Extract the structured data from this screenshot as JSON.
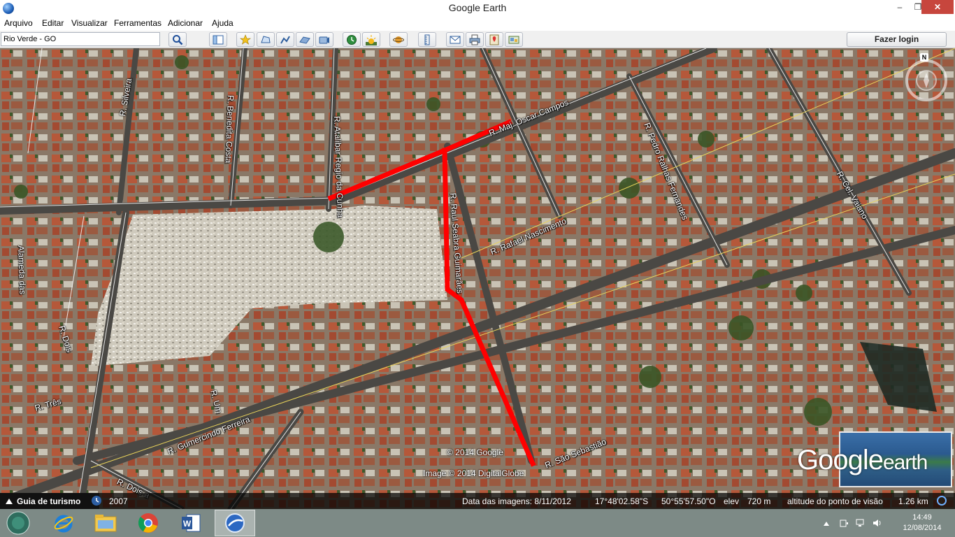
{
  "window": {
    "title": "Google Earth",
    "controls": {
      "minimize": "–",
      "maximize": "❐",
      "close": "✕"
    }
  },
  "menu": [
    "Arquivo",
    "Editar",
    "Visualizar",
    "Ferramentas",
    "Adicionar",
    "Ajuda"
  ],
  "toolbar": {
    "search_value": "Rio Verde - GO",
    "login_label": "Fazer login"
  },
  "map": {
    "streets": [
      "R. Atalibar Regio da Cunha",
      "R. Benedita Costa",
      "R. Silveira",
      "R. Maj. Oscar Campos",
      "R. Pedro Ralhas Fernandes",
      "R. Cel. Vaiano",
      "R. Rafael Nascimento",
      "R. Raul Seabra Guimarães",
      "Alameda das",
      "R. Dois",
      "R. Três",
      "R. Um",
      "R. Gumercindo Ferreira",
      "R. Dois-a",
      "R. São Sebastião"
    ],
    "copyright_google": "© 2014 Google",
    "copyright_imagery": "Image © 2014 DigitalGlobe",
    "route_color": "#ff0000",
    "north_label": "N"
  },
  "logo": {
    "word1": "Google",
    "word2": "earth"
  },
  "status": {
    "tour_guide": "Guia de turismo",
    "year": "2007",
    "image_date": "Data das imagens: 8/11/2012",
    "latitude": "17°48'02.58\"S",
    "longitude": "50°55'57.50\"O",
    "elevation_label": "elev",
    "elevation_value": "720 m",
    "eye_alt_label": "altitude do ponto de visão",
    "eye_alt_value": "1.26 km"
  },
  "taskbar": {
    "apps": [
      "start-icon",
      "internet-explorer-icon",
      "file-explorer-icon",
      "chrome-icon",
      "word-icon",
      "google-earth-icon"
    ],
    "time": "14:49",
    "date": "12/08/2014"
  }
}
